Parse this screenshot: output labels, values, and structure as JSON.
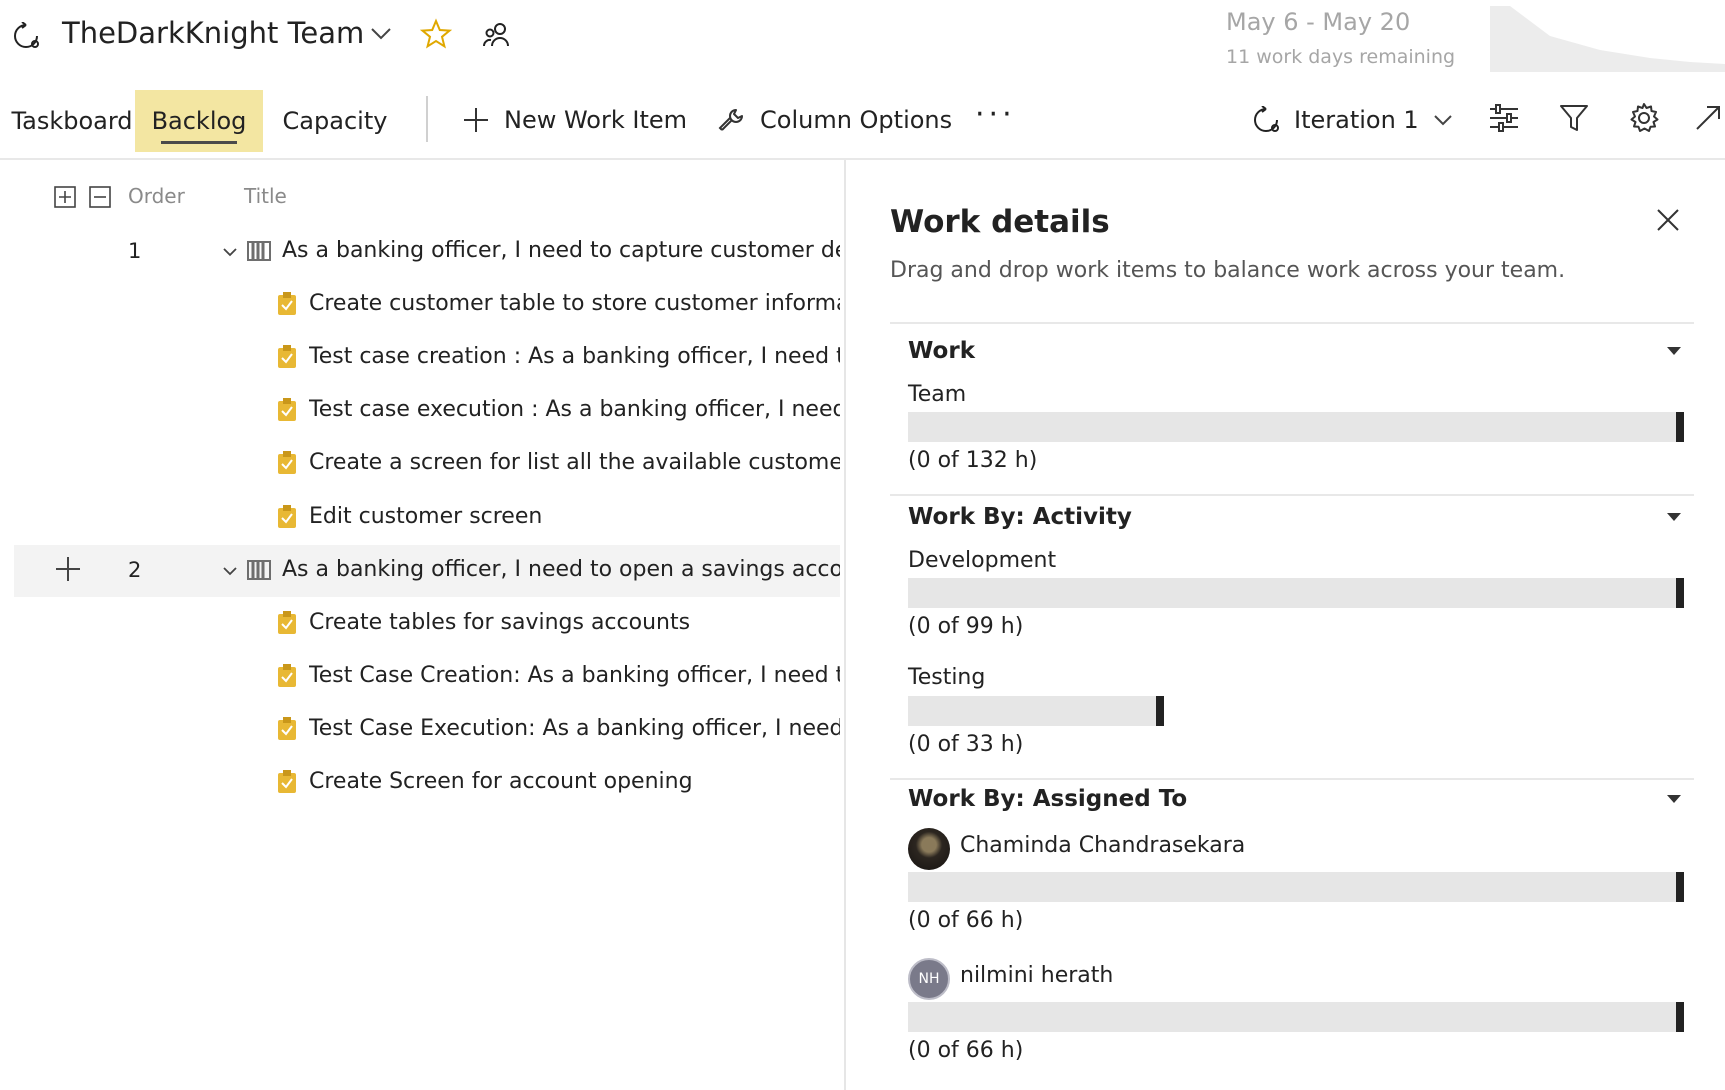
{
  "header": {
    "team_name": "TheDarkKnight Team",
    "sprint_dates": "May 6 - May 20",
    "days_remaining": "11 work days remaining"
  },
  "toolbar": {
    "tabs": [
      {
        "label": "Taskboard",
        "selected": false
      },
      {
        "label": "Backlog",
        "selected": true
      },
      {
        "label": "Capacity",
        "selected": false
      }
    ],
    "new_work_item": "New Work Item",
    "column_options": "Column Options",
    "more": "···",
    "iteration": "Iteration 1"
  },
  "backlog": {
    "columns": {
      "order": "Order",
      "title": "Title"
    },
    "items": [
      {
        "type": "pbi",
        "order": "1",
        "title": "As a banking officer, I need to capture customer details"
      },
      {
        "type": "task",
        "title": "Create customer table to store customer information"
      },
      {
        "type": "task",
        "title": "Test case creation : As a banking officer, I need to m"
      },
      {
        "type": "task",
        "title": "Test case execution : As a banking officer, I need to r"
      },
      {
        "type": "task",
        "title": "Create a screen for list all the available customers wi"
      },
      {
        "type": "task",
        "title": "Edit customer screen"
      },
      {
        "type": "pbi",
        "order": "2",
        "title": "As a banking officer, I need to open a savings account"
      },
      {
        "type": "task",
        "title": "Create tables for savings accounts"
      },
      {
        "type": "task",
        "title": "Test Case Creation: As a banking officer, I need to cr"
      },
      {
        "type": "task",
        "title": "Test Case Execution: As a banking officer, I need to c"
      },
      {
        "type": "task",
        "title": "Create Screen for account opening"
      }
    ]
  },
  "work_details": {
    "title": "Work details",
    "description": "Drag and drop work items to balance work across your team.",
    "sections": {
      "work": {
        "heading": "Work",
        "rows": [
          {
            "label": "Team",
            "hours": "(0 of 132 h)",
            "capacity_fraction": 1.0
          }
        ]
      },
      "activity": {
        "heading": "Work By: Activity",
        "rows": [
          {
            "label": "Development",
            "hours": "(0 of 99 h)",
            "capacity_fraction": 1.0
          },
          {
            "label": "Testing",
            "hours": "(0 of 33 h)",
            "capacity_fraction": 0.33
          }
        ]
      },
      "assigned": {
        "heading": "Work By: Assigned To",
        "rows": [
          {
            "label": "Chaminda Chandrasekara",
            "avatar": "photo",
            "hours": "(0 of 66 h)",
            "capacity_fraction": 1.0
          },
          {
            "label": "nilmini herath",
            "avatar": "NH",
            "hours": "(0 of 66 h)",
            "capacity_fraction": 1.0
          }
        ]
      }
    }
  },
  "colors": {
    "selected_tab": "#f3e6a2",
    "task_icon": "#e8b834",
    "pbi_icon": "#6e6e6e",
    "bar_track": "#e6e6e6",
    "bar_marker": "#222222"
  },
  "icons": [
    "sprint-icon",
    "chevron-down-icon",
    "star-icon",
    "team-members-icon",
    "plus-icon",
    "wrench-icon",
    "more-icon",
    "settings-sliders-icon",
    "filter-icon",
    "gear-icon",
    "expand-icon",
    "close-icon",
    "book-icon",
    "task-clipboard-icon"
  ]
}
